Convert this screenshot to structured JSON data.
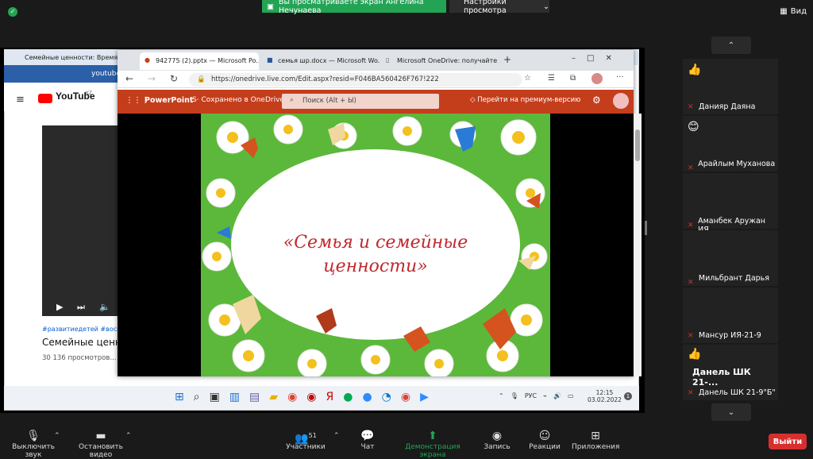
{
  "zoom": {
    "share_banner": "Вы просматриваете экран Ангелина Нечунаева",
    "view_settings": "Настройки просмотра",
    "view_button": "Вид"
  },
  "bg_browser": {
    "tab_title": "Семейные ценности: Время на...",
    "address": "youtube",
    "yt_logo": "YouTube",
    "yt_region": "KZ",
    "tags": "#развитиедетей #воспита...",
    "video_title": "Семейные ценнос...",
    "views": "30 136 просмотров..."
  },
  "edge": {
    "tabs": [
      "942775 (2).pptx — Microsoft Po...",
      "семья шр.docx — Microsoft Wo...",
      "Microsoft OneDrive: получайте..."
    ],
    "url": "https://onedrive.live.com/Edit.aspx?resid=F046BA560426F767!222"
  },
  "powerpoint": {
    "app_name": "PowerPoint",
    "save_status": "Сохранено в OneDrive",
    "search_placeholder": "Поиск (Alt + Ы)",
    "premium_link": "Перейти на премиум-версию",
    "slide_title_line1": "«Семья и семейные",
    "slide_title_line2": "ценности»"
  },
  "taskbar": {
    "lang": "РУС",
    "time": "12:15",
    "date": "03.02.2022"
  },
  "participants": [
    {
      "name": "Данияр Даяна",
      "reaction": "👍"
    },
    {
      "name": "Арайлым Муханова ...",
      "reaction": "😊"
    },
    {
      "name": "Аманбек Аружан ИЯ...",
      "reaction": ""
    },
    {
      "name": "Мильбрант Дарья ...",
      "reaction": ""
    },
    {
      "name": "Мансур ИЯ-21-9",
      "reaction": ""
    },
    {
      "name": "Данель ШК 21-9\"Б\"",
      "reaction": "👍",
      "big_label": "Данель ШК 21-..."
    }
  ],
  "toolbar": {
    "mute": "Выключить звук",
    "video": "Остановить видео",
    "participants": "Участники",
    "participants_count": "51",
    "chat": "Чат",
    "share": "Демонстрация экрана",
    "record": "Запись",
    "reactions": "Реакции",
    "apps": "Приложения",
    "leave": "Выйти"
  },
  "colors": {
    "zoom_green": "#23a455",
    "ppt_red": "#c43e1c",
    "leave_red": "#d72e2e",
    "slide_text": "#c0282d"
  }
}
